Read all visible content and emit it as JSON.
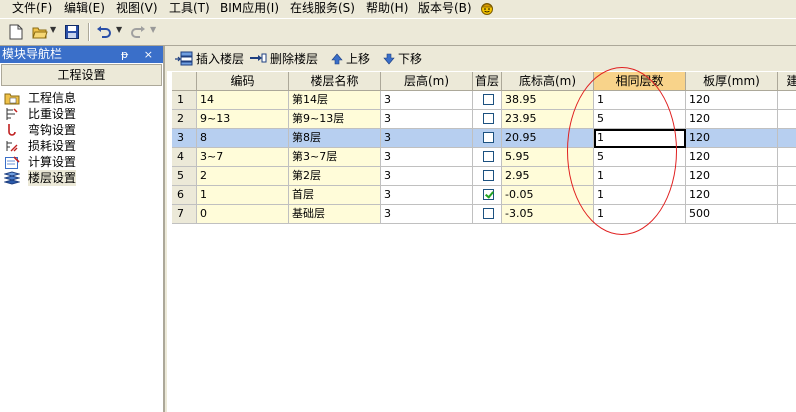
{
  "menu": [
    "文件(F)",
    "编辑(E)",
    "视图(V)",
    "工具(T)",
    "BIM应用(I)",
    "在线服务(S)",
    "帮助(H)",
    "版本号(B)"
  ],
  "nav": {
    "title": "模块导航栏",
    "pin_label": "ᵽ",
    "close_label": "×",
    "header": "工程设置",
    "items": [
      "工程信息",
      "比重设置",
      "弯钩设置",
      "损耗设置",
      "计算设置",
      "楼层设置"
    ]
  },
  "floor_toolbar": {
    "insert": "插入楼层",
    "delete": "删除楼层",
    "up": "上移",
    "down": "下移"
  },
  "table": {
    "headers": [
      "",
      "编码",
      "楼层名称",
      "层高(m)",
      "首层",
      "底标高(m)",
      "相同层数",
      "板厚(mm)",
      "建"
    ],
    "rows": [
      {
        "n": "1",
        "code": "14",
        "name": "第14层",
        "height": "3",
        "first": false,
        "base": "38.95",
        "same": "1",
        "slab": "120"
      },
      {
        "n": "2",
        "code": "9~13",
        "name": "第9~13层",
        "height": "3",
        "first": false,
        "base": "23.95",
        "same": "5",
        "slab": "120"
      },
      {
        "n": "3",
        "code": "8",
        "name": "第8层",
        "height": "3",
        "first": false,
        "base": "20.95",
        "same": "1",
        "slab": "120"
      },
      {
        "n": "4",
        "code": "3~7",
        "name": "第3~7层",
        "height": "3",
        "first": false,
        "base": "5.95",
        "same": "5",
        "slab": "120"
      },
      {
        "n": "5",
        "code": "2",
        "name": "第2层",
        "height": "3",
        "first": false,
        "base": "2.95",
        "same": "1",
        "slab": "120"
      },
      {
        "n": "6",
        "code": "1",
        "name": "首层",
        "height": "3",
        "first": true,
        "base": "-0.05",
        "same": "1",
        "slab": "120"
      },
      {
        "n": "7",
        "code": "0",
        "name": "基础层",
        "height": "3",
        "first": false,
        "base": "-3.05",
        "same": "1",
        "slab": "500"
      }
    ]
  },
  "colors": {
    "nav_title_bg": "#3a6fc9",
    "selected_row": "#b7cff0",
    "header_highlight": "#f8d38a",
    "annotation": "#e02020"
  }
}
